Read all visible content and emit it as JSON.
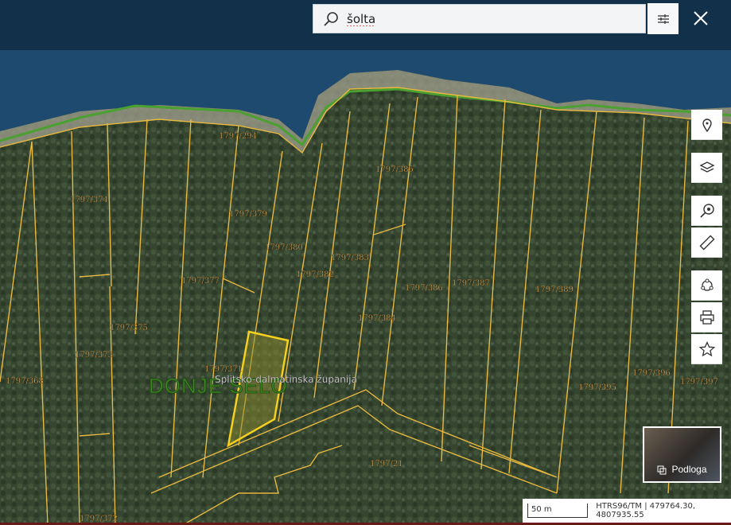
{
  "search": {
    "value": "šolta",
    "placeholder": ""
  },
  "toolbar": [
    "location-pin",
    "layers",
    "search-location",
    "ruler",
    "share",
    "print",
    "star"
  ],
  "map": {
    "place_name": "DONJE SELO",
    "region_label": "Splitsko-dalmatinska županija",
    "parcels": [
      {
        "id": "1797/294"
      },
      {
        "id": "1797/374"
      },
      {
        "id": "1797/379"
      },
      {
        "id": "1797/385"
      },
      {
        "id": "1797/380"
      },
      {
        "id": "1797/383"
      },
      {
        "id": "1797/382"
      },
      {
        "id": "1797/377"
      },
      {
        "id": "1797/386"
      },
      {
        "id": "1797/387"
      },
      {
        "id": "1797/389"
      },
      {
        "id": "1797/384"
      },
      {
        "id": "1797/375"
      },
      {
        "id": "1797/373"
      },
      {
        "id": "1797/371"
      },
      {
        "id": "1797/368"
      },
      {
        "id": "1797/396"
      },
      {
        "id": "1797/397"
      },
      {
        "id": "1797/395"
      },
      {
        "id": "1797/21"
      },
      {
        "id": "1797/372"
      }
    ]
  },
  "basemap": {
    "label": "Podloga"
  },
  "scale": {
    "label": "50 m"
  },
  "coords": {
    "text": "HTRS96/TM | 479764.30, 4807935.55"
  },
  "colors": {
    "header": "#13304a",
    "parcel": "#e8b840",
    "selected": "#f5d020"
  }
}
